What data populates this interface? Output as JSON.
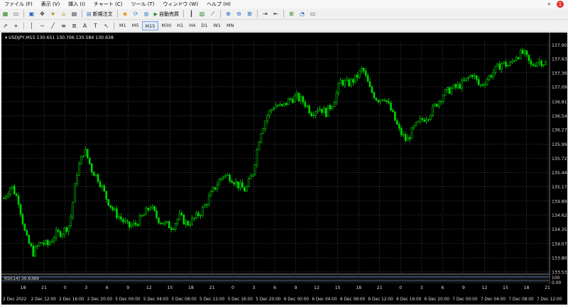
{
  "menu": [
    {
      "label": "ファイル (F)"
    },
    {
      "label": "表示 (V)"
    },
    {
      "label": "挿入 (I)"
    },
    {
      "label": "チャート (C)"
    },
    {
      "label": "ツール (T)"
    },
    {
      "label": "ウィンドウ (W)"
    },
    {
      "label": "ヘルプ (H)"
    }
  ],
  "notification_count": "1",
  "toolbar": {
    "new_order_label": "新規注文",
    "autotrade_label": "自動売買",
    "line_tool_label": "A",
    "timeframes": [
      "M1",
      "M5",
      "M15",
      "M30",
      "H1",
      "H4",
      "D1",
      "W1",
      "MN"
    ]
  },
  "chart": {
    "header": "USDJPY,M15  130.651 130.706 130.584 130.638",
    "rsi_label": "RSI(14) 30.6389",
    "rsi_scale": [
      "100",
      "0.00"
    ],
    "colors": {
      "background": "#000000",
      "candle": "#00d000",
      "grid": "#666666"
    }
  },
  "chart_data": {
    "type": "candlestick",
    "series_label": "USDJPY,M15",
    "y_ticks": [
      "137.905",
      "137.635",
      "137.365",
      "137.095",
      "136.810",
      "136.540",
      "136.270",
      "135.990",
      "135.720",
      "135.445",
      "135.170",
      "134.895",
      "134.625",
      "134.350",
      "134.075",
      "133.800",
      "133.530"
    ],
    "x_labels_top": [
      "18",
      "21",
      "0",
      "3",
      "6",
      "9",
      "12",
      "15",
      "18",
      "21",
      "0",
      "3",
      "6",
      "9",
      "12",
      "15",
      "18",
      "21",
      "0",
      "3",
      "6",
      "9",
      "12",
      "15",
      "18",
      "21"
    ],
    "x_labels_bottom": [
      "2 Dec 2022",
      "2 Dec 12:00",
      "2 Dec 16:00",
      "2 Dec 20:00",
      "5 Dec 00:00",
      "5 Dec 04:00",
      "5 Dec 08:00",
      "5 Dec 12:00",
      "5 Dec 16:00",
      "5 Dec 20:00",
      "6 Dec 00:00",
      "6 Dec 04:00",
      "6 Dec 08:00",
      "6 Dec 12:00",
      "6 Dec 16:00",
      "6 Dec 20:00",
      "7 Dec 00:00",
      "7 Dec 04:00",
      "7 Dec 08:00",
      "7 Dec 12:00"
    ],
    "close_path": [
      134.95,
      135.2,
      134.9,
      134.2,
      133.9,
      134.1,
      134.05,
      134.25,
      134.3,
      134.45,
      135.45,
      135.9,
      135.5,
      135.3,
      134.95,
      134.7,
      134.55,
      134.4,
      134.45,
      134.6,
      134.8,
      134.55,
      134.45,
      134.4,
      134.6,
      134.45,
      134.55,
      134.7,
      134.95,
      135.2,
      135.4,
      135.35,
      135.2,
      135.1,
      135.45,
      136.2,
      136.55,
      136.75,
      136.7,
      136.85,
      136.9,
      136.8,
      136.6,
      136.7,
      136.6,
      136.8,
      137.2,
      137.15,
      137.25,
      137.45,
      137.05,
      136.85,
      136.9,
      136.6,
      136.25,
      136.05,
      136.3,
      136.45,
      136.55,
      136.75,
      136.95,
      137.05,
      137.1,
      137.2,
      137.35,
      137.1,
      137.25,
      137.4,
      137.55,
      137.5,
      137.7,
      137.75,
      137.5,
      137.6,
      137.55
    ],
    "ylim": [
      133.5,
      137.95
    ]
  }
}
